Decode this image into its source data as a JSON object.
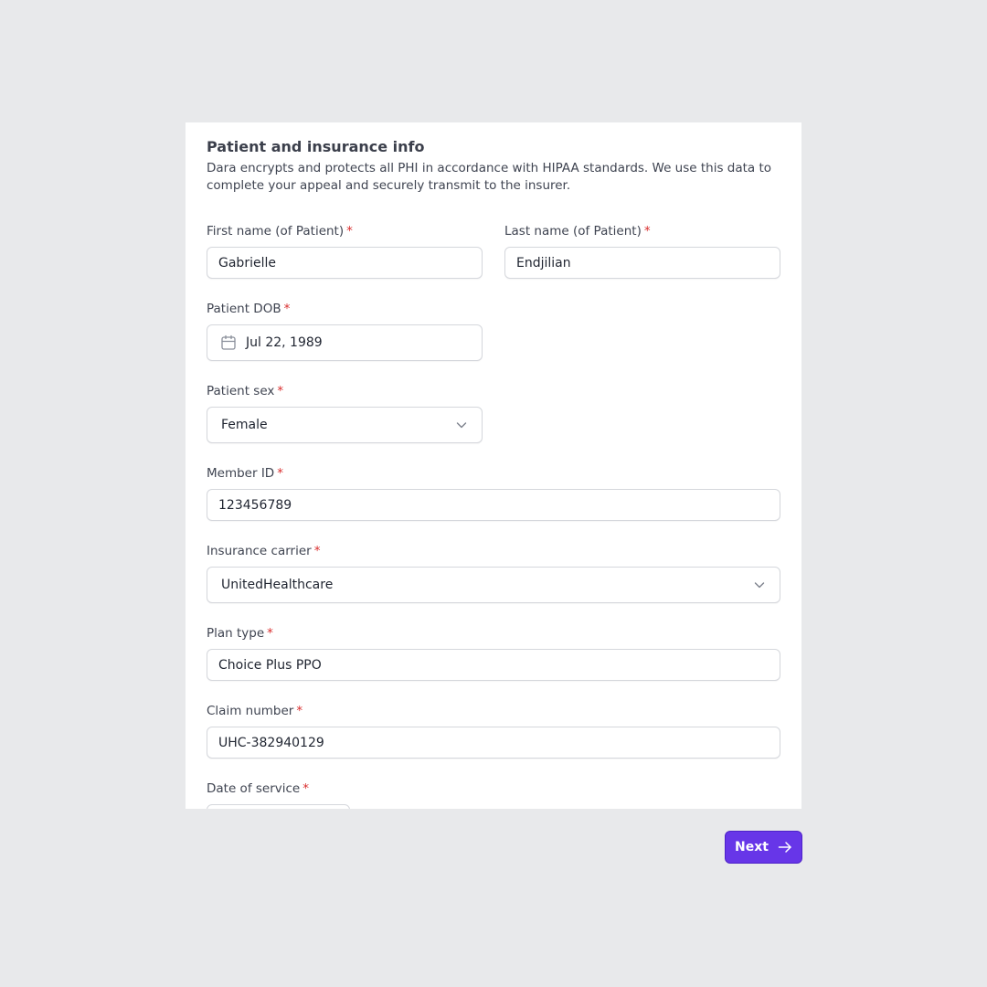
{
  "header": {
    "title": "Patient and insurance info",
    "subtitle": "Dara encrypts and protects all PHI in accordance with HIPAA standards. We use this data to complete your appeal and securely transmit to the insurer."
  },
  "required_marker": "*",
  "fields": {
    "first_name": {
      "label": "First name (of Patient)",
      "value": "Gabrielle"
    },
    "last_name": {
      "label": "Last name (of Patient)",
      "value": "Endjilian"
    },
    "dob": {
      "label": "Patient DOB",
      "value": "Jul 22, 1989"
    },
    "sex": {
      "label": "Patient sex",
      "value": "Female"
    },
    "member_id": {
      "label": "Member ID",
      "value": "123456789"
    },
    "carrier": {
      "label": "Insurance carrier",
      "value": "UnitedHealthcare"
    },
    "plan_type": {
      "label": "Plan type",
      "value": "Choice Plus PPO"
    },
    "claim_number": {
      "label": "Claim number",
      "value": "UHC-382940129"
    },
    "date_of_service": {
      "label": "Date of service",
      "value": ""
    }
  },
  "footer": {
    "next_label": "Next"
  },
  "colors": {
    "accent": "#6736e8",
    "required": "#d92d2d",
    "background": "#e8e9eb"
  },
  "icons": {
    "date": "calendar-icon",
    "select": "chevron-down-icon",
    "next": "arrow-right-icon"
  }
}
